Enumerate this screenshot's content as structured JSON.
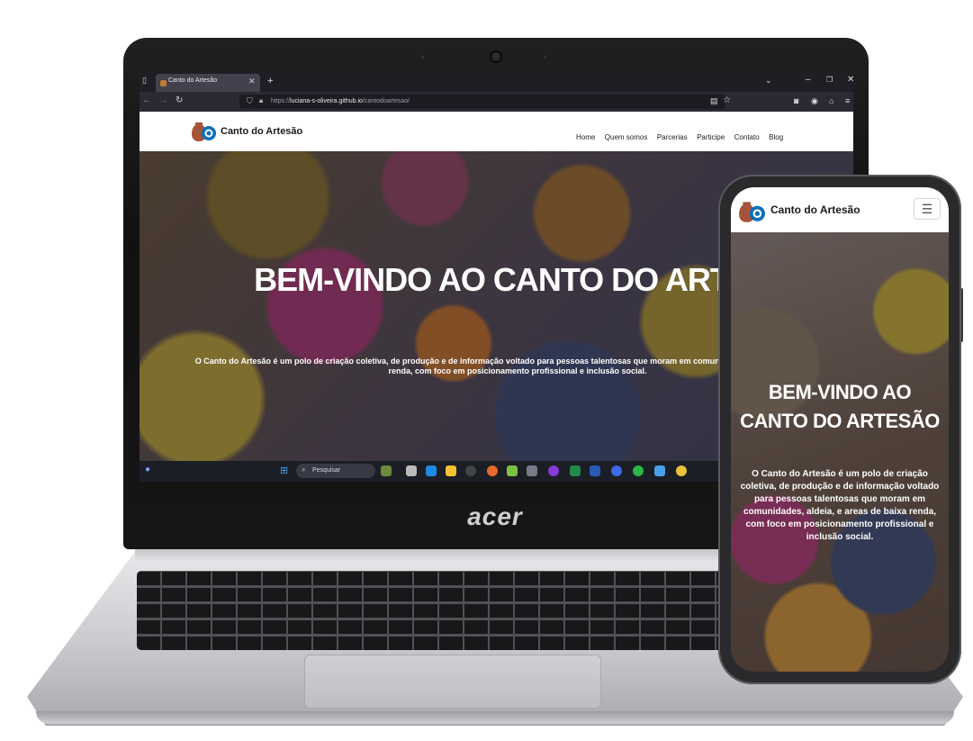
{
  "laptop": {
    "brand": "acer",
    "browser": {
      "tab_title": "Canto do Artesão",
      "url_prefix": "https://",
      "url_host": "luciana-s-oliveira.github.io",
      "url_path": "/cantodoartesao/"
    },
    "taskbar": {
      "search_placeholder": "Pesquisar"
    }
  },
  "site": {
    "brand_name": "Canto do Artesão",
    "menu": [
      "Home",
      "Quem somos",
      "Parcerias",
      "Participe",
      "Contato",
      "Blog"
    ],
    "hero": {
      "title": "BEM-VINDO AO CANTO DO ARTESÃO",
      "text": "O Canto do Artesão é um polo de criação coletiva, de produção e de informação voltado para pessoas talentosas que moram em comunidades, aldeia, e areas de baixa renda, com foco em posicionamento profissional e inclusão social."
    }
  },
  "phone": {
    "brand_name": "Canto do Artesão",
    "hero_title": "BEM-VINDO AO CANTO DO ARTESÃO",
    "hero_text": "O Canto do Artesão é um polo de criação coletiva, de produção e de informação voltado para pessoas talentosas que moram em comunidades, aldeia, e areas de baixa renda, com foco em posicionamento profissional e inclusão social."
  },
  "colors": {
    "accent": "#0b6fb8",
    "logo_pot": "#a5533a",
    "browser_dark": "#1f1e25"
  }
}
